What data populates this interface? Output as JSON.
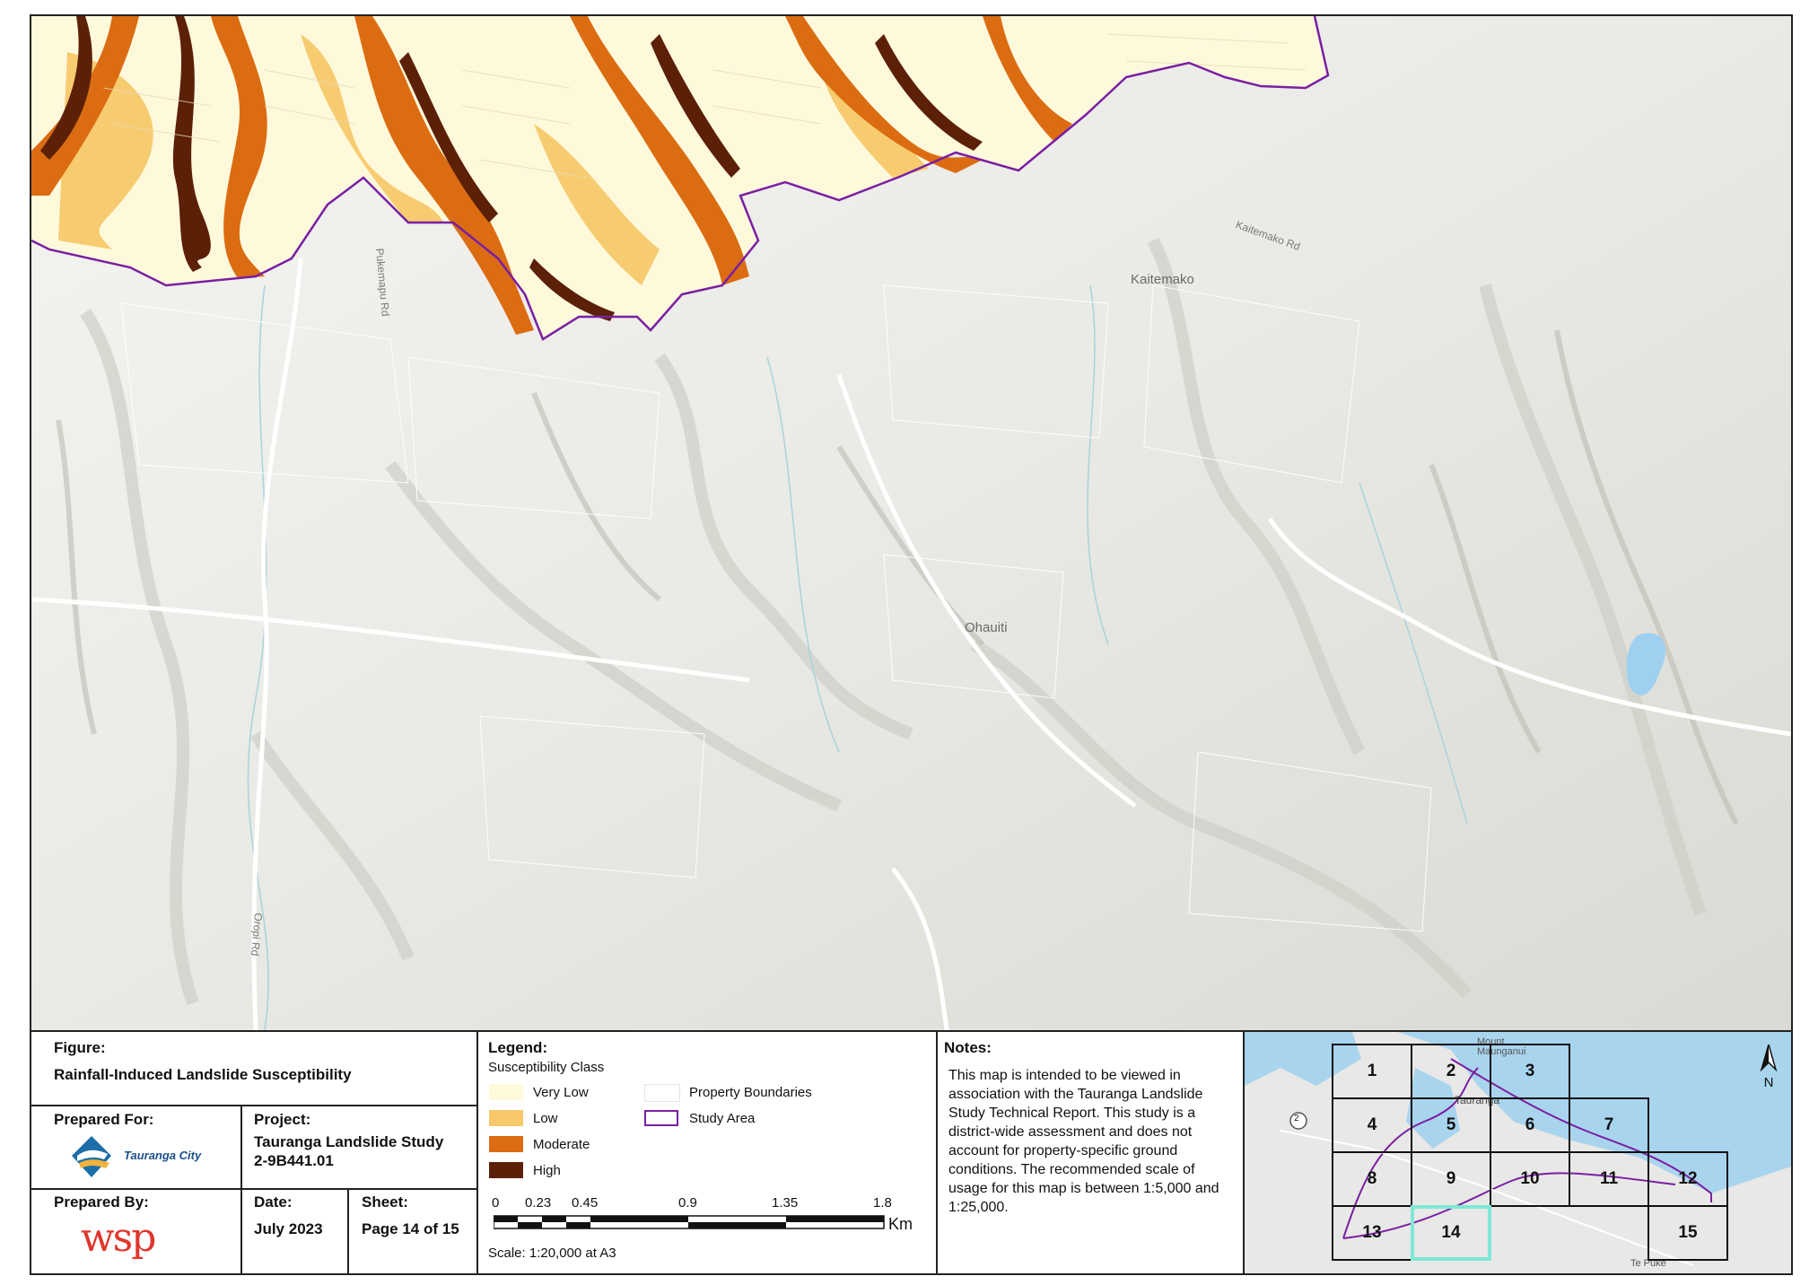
{
  "map": {
    "places": [
      "Kaitemako",
      "Ohauiti"
    ],
    "roads": [
      "Pukemapu Rd",
      "Kaitemako Rd",
      "Oropi Rd"
    ],
    "colors": {
      "very_low": "#fff9dc",
      "low": "#f7c96a",
      "moderate": "#db6c12",
      "high": "#5c2007",
      "study_area": "#7a1fa2",
      "property": "#ffffff"
    }
  },
  "figure": {
    "label": "Figure:",
    "title": "Rainfall-Induced Landslide Susceptibility"
  },
  "prepared_for": {
    "label": "Prepared For:",
    "logo_text": "Tauranga City"
  },
  "project": {
    "label": "Project:",
    "name": "Tauranga Landslide Study",
    "code": "2-9B441.01"
  },
  "prepared_by": {
    "label": "Prepared By:",
    "logo_text": "wsp"
  },
  "date": {
    "label": "Date:",
    "value": "July 2023"
  },
  "sheet": {
    "label": "Sheet:",
    "value": "Page 14 of 15"
  },
  "legend": {
    "title": "Legend:",
    "subtitle": "Susceptibility Class",
    "classes": [
      "Very Low",
      "Low",
      "Moderate",
      "High"
    ],
    "property_boundaries": "Property Boundaries",
    "study_area": "Study Area",
    "scale_ticks": [
      "0",
      "0.23",
      "0.45",
      "0.9",
      "1.35",
      "1.8"
    ],
    "scale_unit": "Km",
    "scale_text": "Scale: 1:20,000 at A3"
  },
  "notes": {
    "title": "Notes:",
    "text": "This map is intended to be viewed in association with the Tauranga Landslide Study Technical Report. This study is a district-wide assessment and does not account for property-specific ground conditions. The recommended scale of usage for this map is between 1:5,000 and 1:25,000."
  },
  "inset": {
    "labels": [
      "Mount Maunganui",
      "Tauranga",
      "Te Puke",
      "2",
      "N"
    ],
    "sheets": [
      "1",
      "2",
      "3",
      "4",
      "5",
      "6",
      "7",
      "8",
      "9",
      "10",
      "11",
      "12",
      "13",
      "14",
      "15"
    ],
    "current_sheet": "14"
  }
}
